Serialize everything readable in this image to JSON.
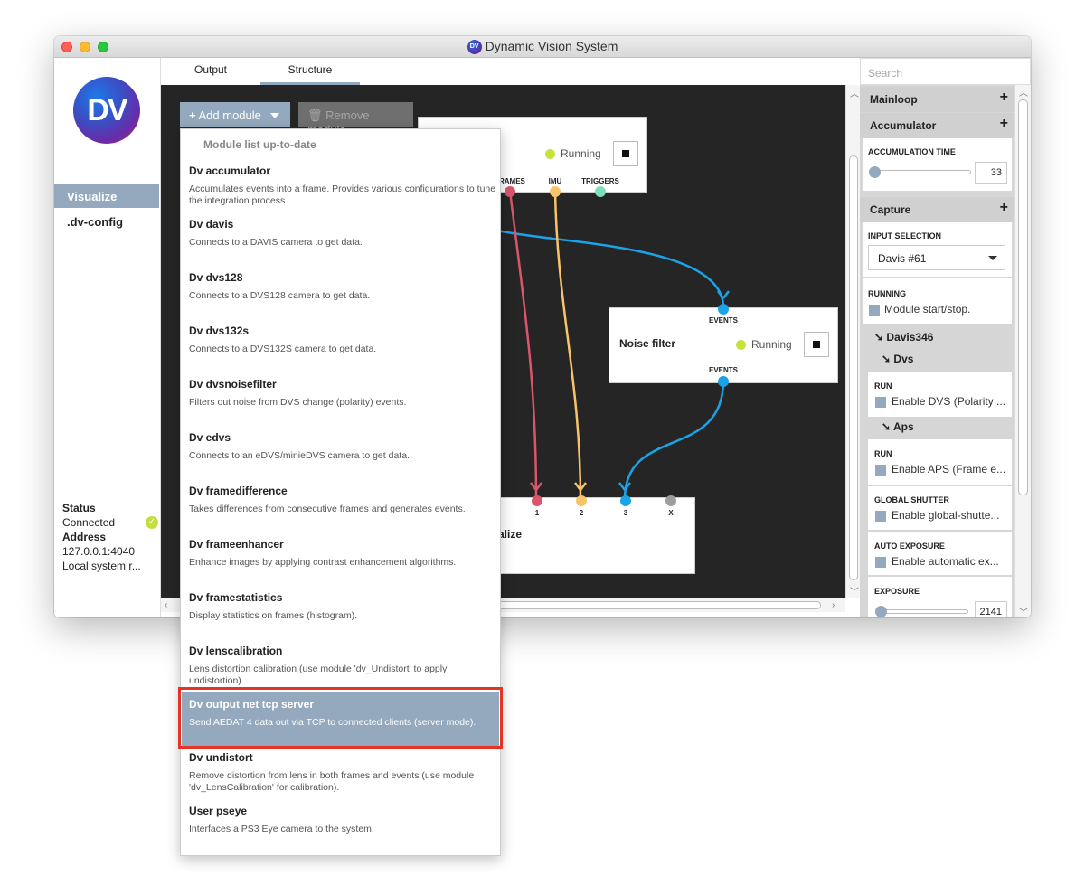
{
  "window": {
    "title": "Dynamic Vision System",
    "logo_text": "DV"
  },
  "sidebar": {
    "logo_text": "DV",
    "items": [
      {
        "label": "Visualize"
      },
      {
        "label": ".dv-config"
      }
    ],
    "status_label": "Status",
    "status_value": "Connected",
    "address_label": "Address",
    "address_value": "127.0.0.1:4040",
    "address_desc": "Local system r..."
  },
  "tabs": [
    {
      "label": "Output"
    },
    {
      "label": "Structure"
    }
  ],
  "toolbar": {
    "add_label": "Add module",
    "remove_label": "Remove module"
  },
  "nodes": {
    "capture": {
      "status": "Running",
      "ports": [
        "FRAMES",
        "IMU",
        "TRIGGERS"
      ]
    },
    "noise": {
      "title": "Noise filter",
      "status": "Running",
      "in_port": "EVENTS",
      "out_port": "EVENTS"
    },
    "visualize": {
      "title_partial": "alize",
      "ports": [
        "1",
        "2",
        "3",
        "X"
      ]
    }
  },
  "dropdown": {
    "header": "Module list up-to-date",
    "items": [
      {
        "name": "Dv accumulator",
        "desc": "Accumulates events into a frame. Provides various configurations to tune the integration process"
      },
      {
        "name": "Dv davis",
        "desc": "Connects to a DAVIS camera to get data."
      },
      {
        "name": "Dv dvs128",
        "desc": "Connects to a DVS128 camera to get data."
      },
      {
        "name": "Dv dvs132s",
        "desc": "Connects to a DVS132S camera to get data."
      },
      {
        "name": "Dv dvsnoisefilter",
        "desc": "Filters out noise from DVS change (polarity) events."
      },
      {
        "name": "Dv edvs",
        "desc": "Connects to an eDVS/minieDVS camera to get data."
      },
      {
        "name": "Dv framedifference",
        "desc": "Takes differences from consecutive frames and generates events."
      },
      {
        "name": "Dv frameenhancer",
        "desc": "Enhance images by applying contrast enhancement algorithms."
      },
      {
        "name": "Dv framestatistics",
        "desc": "Display statistics on frames (histogram)."
      },
      {
        "name": "Dv lenscalibration",
        "desc": "Lens distortion calibration (use module 'dv_Undistort' to apply undistortion)."
      },
      {
        "name": "Dv output net tcp server",
        "desc": "Send AEDAT 4 data out via TCP to connected clients (server mode)."
      },
      {
        "name": "Dv undistort",
        "desc": "Remove distortion from lens in both frames and events (use module 'dv_LensCalibration' for calibration)."
      },
      {
        "name": "User pseye",
        "desc": "Interfaces a PS3 Eye camera to the system."
      }
    ]
  },
  "rightpanel": {
    "search_placeholder": "Search",
    "mainloop": "Mainloop",
    "accumulator": "Accumulator",
    "accumulation_time_label": "ACCUMULATION TIME",
    "accumulation_time_value": "33",
    "capture": "Capture",
    "input_selection_label": "INPUT SELECTION",
    "input_selection_value": "Davis #61",
    "running_label": "RUNNING",
    "running_check": "Module start/stop.",
    "davis346": "Davis346",
    "dvs": "Dvs",
    "dvs_run_label": "RUN",
    "dvs_run_check": "Enable DVS (Polarity ...",
    "aps": "Aps",
    "aps_run_label": "RUN",
    "aps_run_check": "Enable APS (Frame e...",
    "global_shutter_label": "GLOBAL SHUTTER",
    "global_shutter_check": "Enable global-shutte...",
    "auto_exposure_label": "AUTO EXPOSURE",
    "auto_exposure_check": "Enable automatic ex...",
    "exposure_label": "EXPOSURE",
    "exposure_value": "2141"
  },
  "colors": {
    "accent": "#94a9bd",
    "running": "#c5e33c",
    "events": "#1aa3e8",
    "frames": "#d9566b",
    "imu": "#f7c46a",
    "triggers": "#7de0b8",
    "highlight": "#e53324"
  }
}
